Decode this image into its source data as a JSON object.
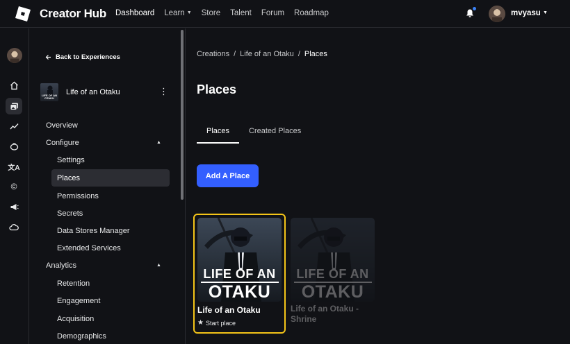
{
  "header": {
    "brand": "Creator Hub",
    "nav": [
      {
        "label": "Dashboard",
        "active": true
      },
      {
        "label": "Learn",
        "dropdown": true
      },
      {
        "label": "Store"
      },
      {
        "label": "Talent"
      },
      {
        "label": "Forum"
      },
      {
        "label": "Roadmap"
      }
    ],
    "username": "mvyasu",
    "notification_dot_color": "#3b82f6"
  },
  "rail": {
    "icons": [
      "home-icon",
      "creations-icon",
      "analytics-icon",
      "monetization-icon",
      "translate-icon",
      "copyright-icon",
      "announce-icon",
      "cloud-icon"
    ],
    "selected": "creations-icon"
  },
  "sidebar": {
    "back_label": "Back to Experiences",
    "experience": {
      "title": "Life of an Otaku",
      "thumb_text_1": "LIFE OF AN",
      "thumb_text_2": "OTAKU"
    },
    "overview": "Overview",
    "configure": "Configure",
    "configure_items": [
      "Settings",
      "Places",
      "Permissions",
      "Secrets",
      "Data Stores Manager",
      "Extended Services"
    ],
    "selected_item": "Places",
    "analytics": "Analytics",
    "analytics_items": [
      "Retention",
      "Engagement",
      "Acquisition",
      "Demographics"
    ]
  },
  "main": {
    "breadcrumb": [
      "Creations",
      "Life of an Otaku",
      "Places"
    ],
    "title": "Places",
    "tabs": [
      {
        "label": "Places",
        "active": true
      },
      {
        "label": "Created Places"
      }
    ],
    "add_button": "Add A Place",
    "places": [
      {
        "name": "Life of an Otaku",
        "badge": "Start place",
        "thumb_line1": "LIFE OF AN",
        "thumb_line2": "OTAKU",
        "highlighted": true
      },
      {
        "name": "Life of an Otaku - Shrine",
        "thumb_line1": "LIFE OF AN",
        "thumb_line2": "OTAKU",
        "highlighted": false
      }
    ]
  },
  "colors": {
    "accent": "#335fff",
    "highlight": "#f5c518",
    "background": "#111216"
  }
}
